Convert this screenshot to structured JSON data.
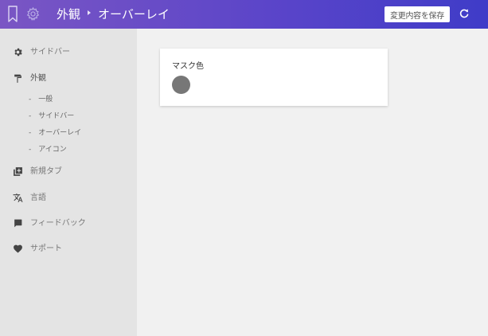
{
  "header": {
    "breadcrumb": [
      "外観",
      "オーバーレイ"
    ],
    "save_label": "変更内容を保存",
    "icons": [
      "bookmark-icon",
      "gear-icon",
      "reload-icon"
    ]
  },
  "sidebar": {
    "items": [
      {
        "label": "サイドバー",
        "icon": "gear-icon"
      },
      {
        "label": "外観",
        "icon": "paint-roller-icon"
      },
      {
        "label": "新規タブ",
        "icon": "new-tab-icon"
      },
      {
        "label": "言語",
        "icon": "translate-icon"
      },
      {
        "label": "フィードバック",
        "icon": "comment-icon"
      },
      {
        "label": "サポート",
        "icon": "heart-icon"
      }
    ],
    "subitems": [
      "-　一般",
      "-　サイドバー",
      "-　オーバーレイ",
      "-　アイコン"
    ]
  },
  "card": {
    "label": "マスク色",
    "mask_color": "#777777"
  },
  "colors": {
    "header_start": "#7a56c4",
    "header_end": "#3f3cc8",
    "sidebar_bg": "#e4e4e4",
    "content_bg": "#f1f1f1"
  }
}
